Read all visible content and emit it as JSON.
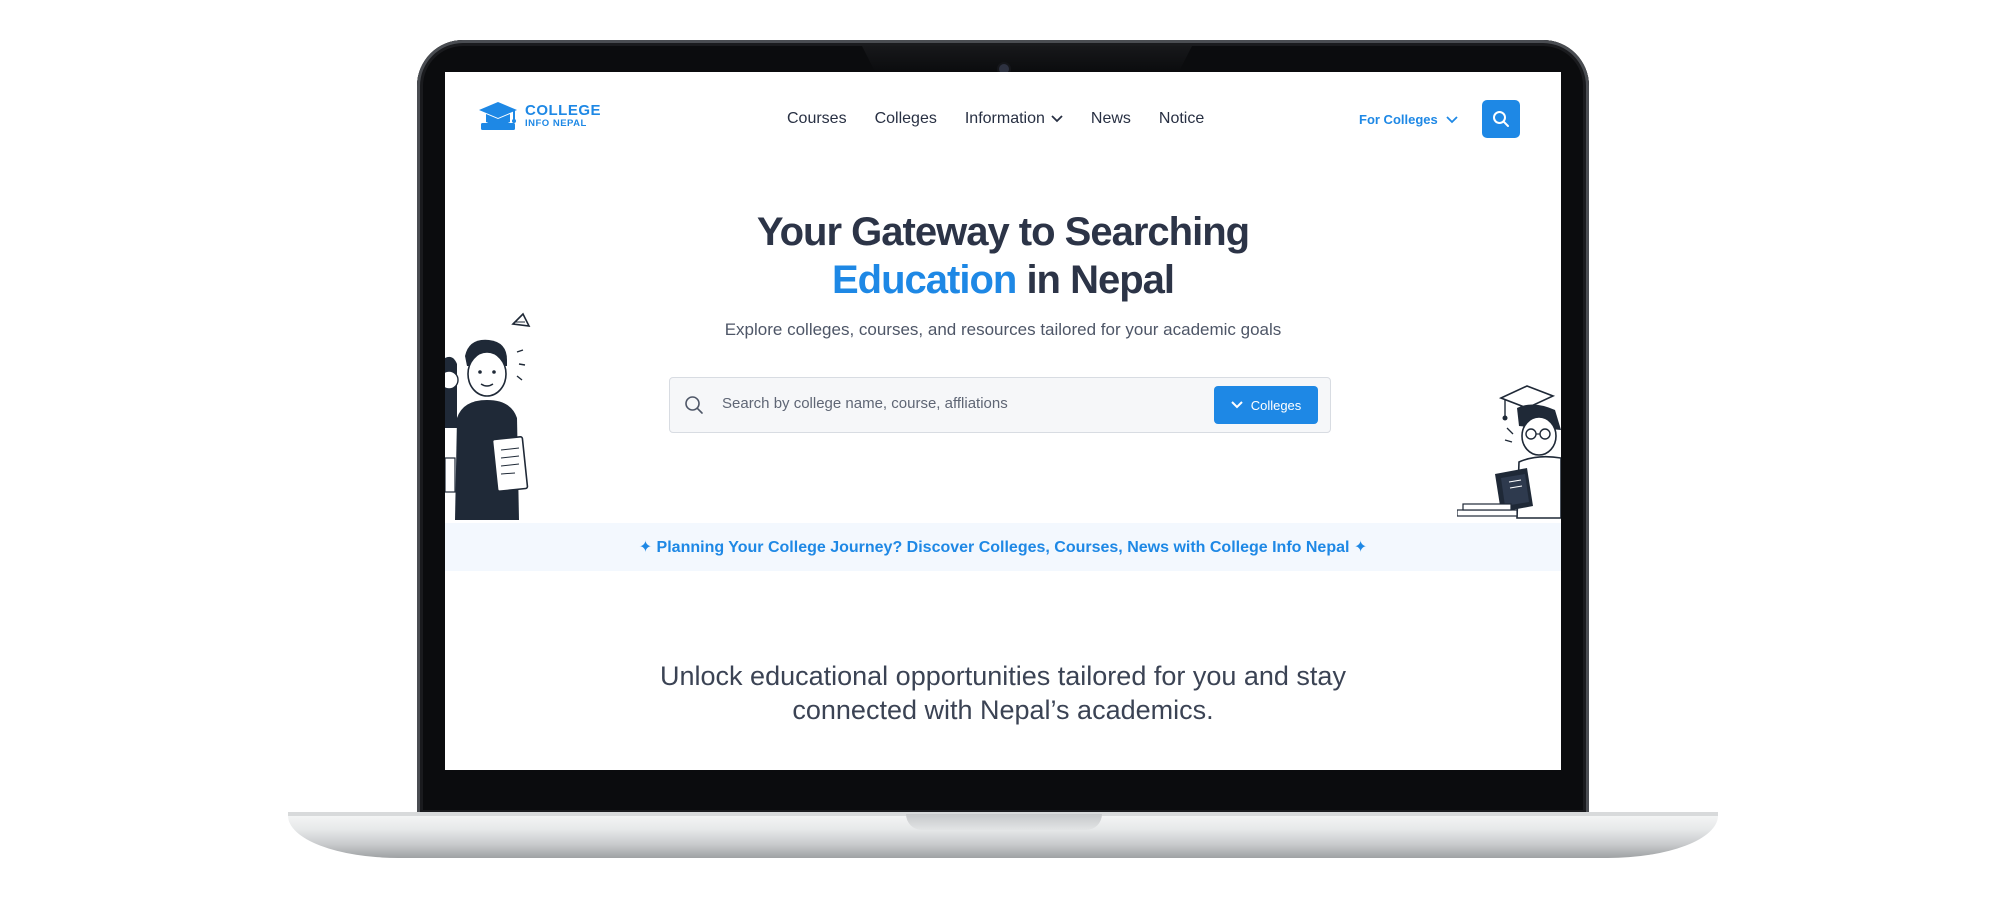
{
  "brand": {
    "line1": "COLLEGE",
    "line2": "INFO NEPAL",
    "color": "#1e88e5"
  },
  "nav": {
    "items": [
      {
        "label": "Courses"
      },
      {
        "label": "Colleges"
      },
      {
        "label": "Information",
        "has_dropdown": true
      },
      {
        "label": "News"
      },
      {
        "label": "Notice"
      }
    ]
  },
  "header": {
    "for_colleges_label": "For Colleges",
    "search_icon": "search-icon"
  },
  "hero": {
    "title_part1": "Your Gateway to Searching",
    "title_accent": "Education",
    "title_part2": "in Nepal",
    "subtitle": "Explore colleges, courses, and resources tailored for your academic goals"
  },
  "search": {
    "placeholder": "Search by college name, course, affliations",
    "filter_label": "Colleges"
  },
  "banner": {
    "text": "✦ Planning Your College Journey? Discover Colleges, Courses, News with College Info Nepal ✦"
  },
  "tagline": {
    "line1": "Unlock educational opportunities tailored for you and stay",
    "line2": "connected with Nepal’s academics."
  },
  "colors": {
    "accent": "#1e88e5",
    "heading": "#2c3447",
    "banner_bg": "#f3f8fe"
  }
}
